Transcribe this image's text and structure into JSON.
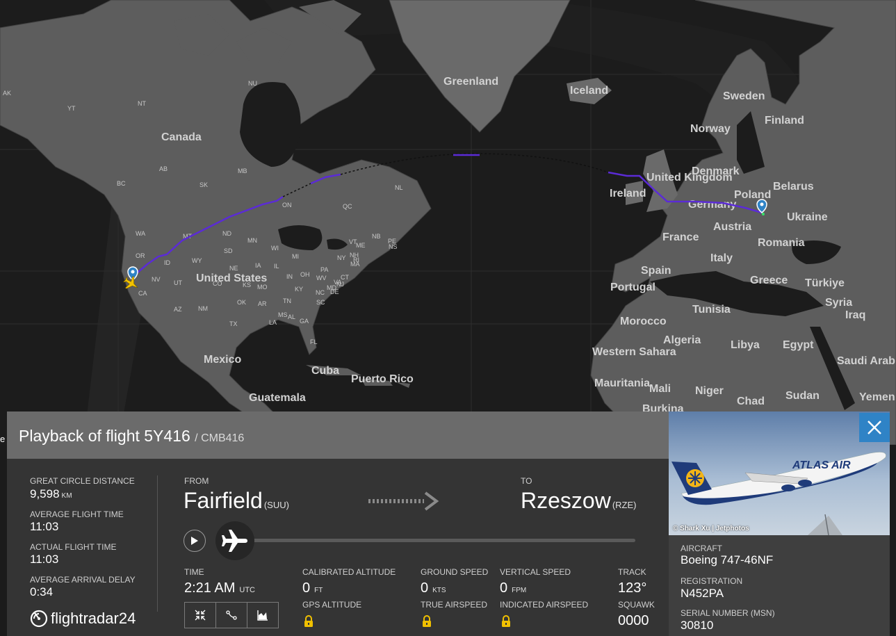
{
  "map": {
    "countries": [
      "Canada",
      "United States",
      "Mexico",
      "Cuba",
      "Puerto Rico",
      "Guatemala",
      "Greenland",
      "Iceland",
      "Sweden",
      "Finland",
      "Norway",
      "Denmark",
      "United Kingdom",
      "Ireland",
      "Poland",
      "Belarus",
      "Germany",
      "Ukraine",
      "Austria",
      "France",
      "Romania",
      "Italy",
      "Spain",
      "Portugal",
      "Greece",
      "Türkiye",
      "Syria",
      "Iraq",
      "Tunisia",
      "Morocco",
      "Algeria",
      "Libya",
      "Egypt",
      "Western Sahara",
      "Mauritania",
      "Mali",
      "Niger",
      "Chad",
      "Sudan",
      "Saudi Arabia",
      "Yemen",
      "Burkina"
    ],
    "regions": [
      "AK",
      "YT",
      "NT",
      "NU",
      "BC",
      "AB",
      "SK",
      "MB",
      "ON",
      "QC",
      "NL",
      "NB",
      "PE",
      "NS",
      "WA",
      "OR",
      "CA",
      "NV",
      "ID",
      "MT",
      "WY",
      "UT",
      "AZ",
      "NM",
      "CO",
      "ND",
      "SD",
      "NE",
      "KS",
      "OK",
      "TX",
      "MN",
      "IA",
      "MO",
      "AR",
      "LA",
      "WI",
      "IL",
      "MI",
      "IN",
      "OH",
      "KY",
      "TN",
      "MS",
      "AL",
      "GA",
      "SC",
      "NC",
      "VA",
      "WV",
      "PA",
      "NY",
      "VT",
      "NH",
      "MA",
      "CT",
      "NJ",
      "DE",
      "MD",
      "RI",
      "ME",
      "FL"
    ],
    "edge_letter": "e"
  },
  "panel": {
    "title": "Playback of flight 5Y416",
    "callsign": "/ CMB416",
    "stats": [
      {
        "label": "GREAT CIRCLE DISTANCE",
        "value": "9,598",
        "unit": "KM"
      },
      {
        "label": "AVERAGE FLIGHT TIME",
        "value": "11:03",
        "unit": ""
      },
      {
        "label": "ACTUAL FLIGHT TIME",
        "value": "11:03",
        "unit": ""
      },
      {
        "label": "AVERAGE ARRIVAL DELAY",
        "value": "0:34",
        "unit": ""
      }
    ],
    "from_label": "FROM",
    "from_city": "Fairfield",
    "from_code": "(SUU)",
    "to_label": "TO",
    "to_city": "Rzeszow",
    "to_code": "(RZE)",
    "playback_progress": 0.0,
    "time_label": "TIME",
    "time_value": "2:21 AM",
    "time_unit": "UTC",
    "cal_alt_label": "CALIBRATED ALTITUDE",
    "cal_alt_value": "0",
    "cal_alt_unit": "FT",
    "gps_alt_label": "GPS ALTITUDE",
    "ground_speed_label": "GROUND SPEED",
    "ground_speed_value": "0",
    "ground_speed_unit": "KTS",
    "true_airspeed_label": "TRUE AIRSPEED",
    "vertical_speed_label": "VERTICAL SPEED",
    "vertical_speed_value": "0",
    "vertical_speed_unit": "FPM",
    "indicated_airspeed_label": "INDICATED AIRSPEED",
    "track_label": "TRACK",
    "track_value": "123°",
    "squawk_label": "SQUAWK",
    "squawk_value": "0000",
    "logo_text": "flightradar24",
    "photo_credit": "© Shark Xu | Jetphotos",
    "photo_livery": "ATLAS AIR",
    "aircraft_label": "AIRCRAFT",
    "aircraft_value": "Boeing 747-46NF",
    "registration_label": "REGISTRATION",
    "registration_value": "N452PA",
    "serial_label": "SERIAL NUMBER (MSN)",
    "serial_value": "30810"
  },
  "colors": {
    "flight_path": "#5b2bd6",
    "close_button": "#2f83c6",
    "airport_pin": "#2f83c6",
    "aircraft_marker": "#f2c200",
    "lock_icon": "#f0c000"
  }
}
